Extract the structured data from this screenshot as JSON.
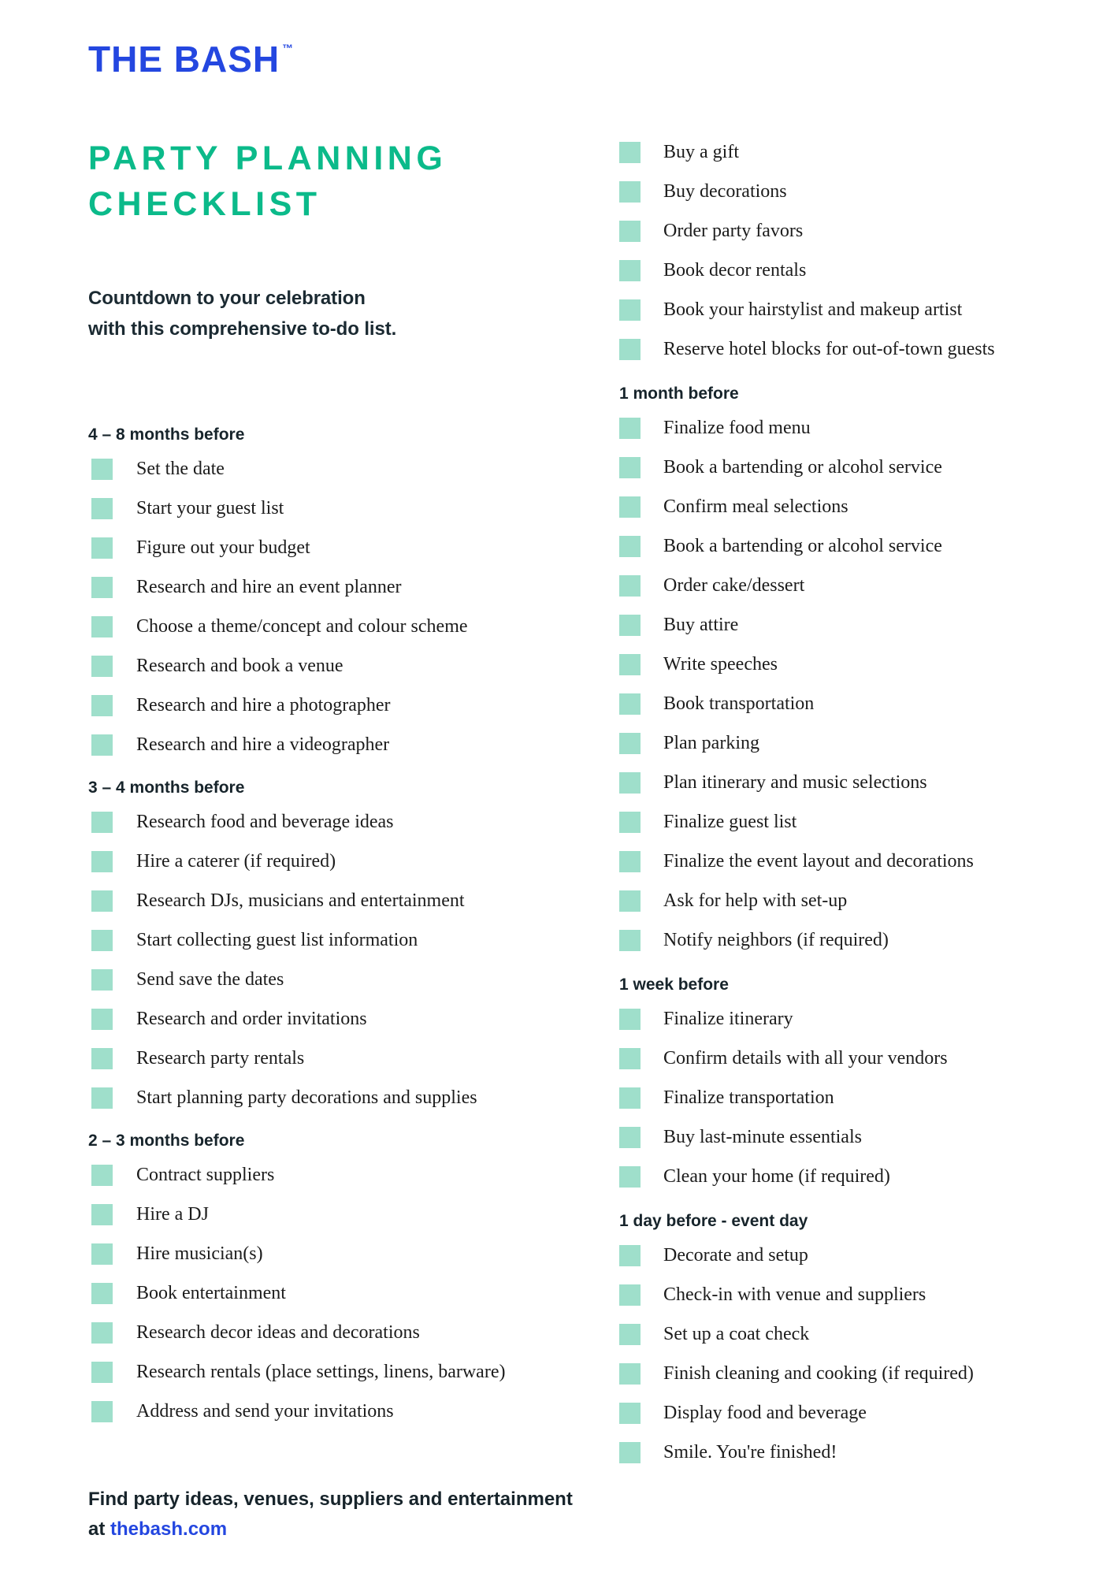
{
  "brand": {
    "logo_text": "THE BASH",
    "trademark": "™",
    "logo_color": "#2447e0"
  },
  "header": {
    "title": "PARTY PLANNING CHECKLIST",
    "subtitle_line1": "Countdown to your celebration",
    "subtitle_line2": "with this comprehensive to-do list.",
    "title_color": "#0bba8a"
  },
  "checkbox_color": "#9fdfcb",
  "left_column": [
    {
      "heading": "4 – 8 months before",
      "items": [
        "Set the date",
        "Start your guest list",
        "Figure out your budget",
        "Research and hire an event planner",
        "Choose a theme/concept and colour scheme",
        "Research and book a venue",
        "Research and hire a photographer",
        "Research and hire a videographer"
      ]
    },
    {
      "heading": "3 – 4 months before",
      "items": [
        "Research food and beverage ideas",
        "Hire a caterer (if required)",
        "Research DJs, musicians and entertainment",
        "Start collecting guest list information",
        "Send save the dates",
        "Research and order invitations",
        "Research party rentals",
        "Start planning party decorations and supplies"
      ]
    },
    {
      "heading": "2 – 3 months before",
      "items": [
        "Contract suppliers",
        "Hire a DJ",
        "Hire musician(s)",
        "Book entertainment",
        "Research decor ideas and decorations",
        "Research rentals (place settings, linens, barware)",
        "Address and send your invitations"
      ]
    }
  ],
  "right_column": [
    {
      "heading": "",
      "items": [
        "Buy a gift",
        "Buy decorations",
        "Order party favors",
        "Book decor rentals",
        "Book your hairstylist and makeup artist",
        "Reserve hotel blocks for out-of-town guests"
      ]
    },
    {
      "heading": "1 month before",
      "items": [
        "Finalize food menu",
        "Book a bartending or alcohol service",
        "Confirm meal selections",
        "Book a bartending or alcohol service",
        "Order cake/dessert",
        "Buy attire",
        "Write speeches",
        "Book transportation",
        "Plan parking",
        "Plan itinerary and music selections",
        "Finalize guest list",
        "Finalize the event layout and decorations",
        "Ask for help with set-up",
        "Notify neighbors (if required)"
      ]
    },
    {
      "heading": "1 week before",
      "items": [
        "Finalize itinerary",
        "Confirm details with all your vendors",
        "Finalize transportation",
        "Buy last-minute essentials",
        "Clean your home (if required)"
      ]
    },
    {
      "heading": "1 day before - event  day",
      "items": [
        "Decorate and setup",
        "Check-in with venue and suppliers",
        "Set up a coat check",
        "Finish cleaning and cooking (if required)",
        "Display food and beverage",
        "Smile. You're finished!"
      ]
    }
  ],
  "footer": {
    "text_before": "Find party ideas, venues, suppliers and entertainment at ",
    "link_text": "thebash.com",
    "link_color": "#2447e0"
  }
}
